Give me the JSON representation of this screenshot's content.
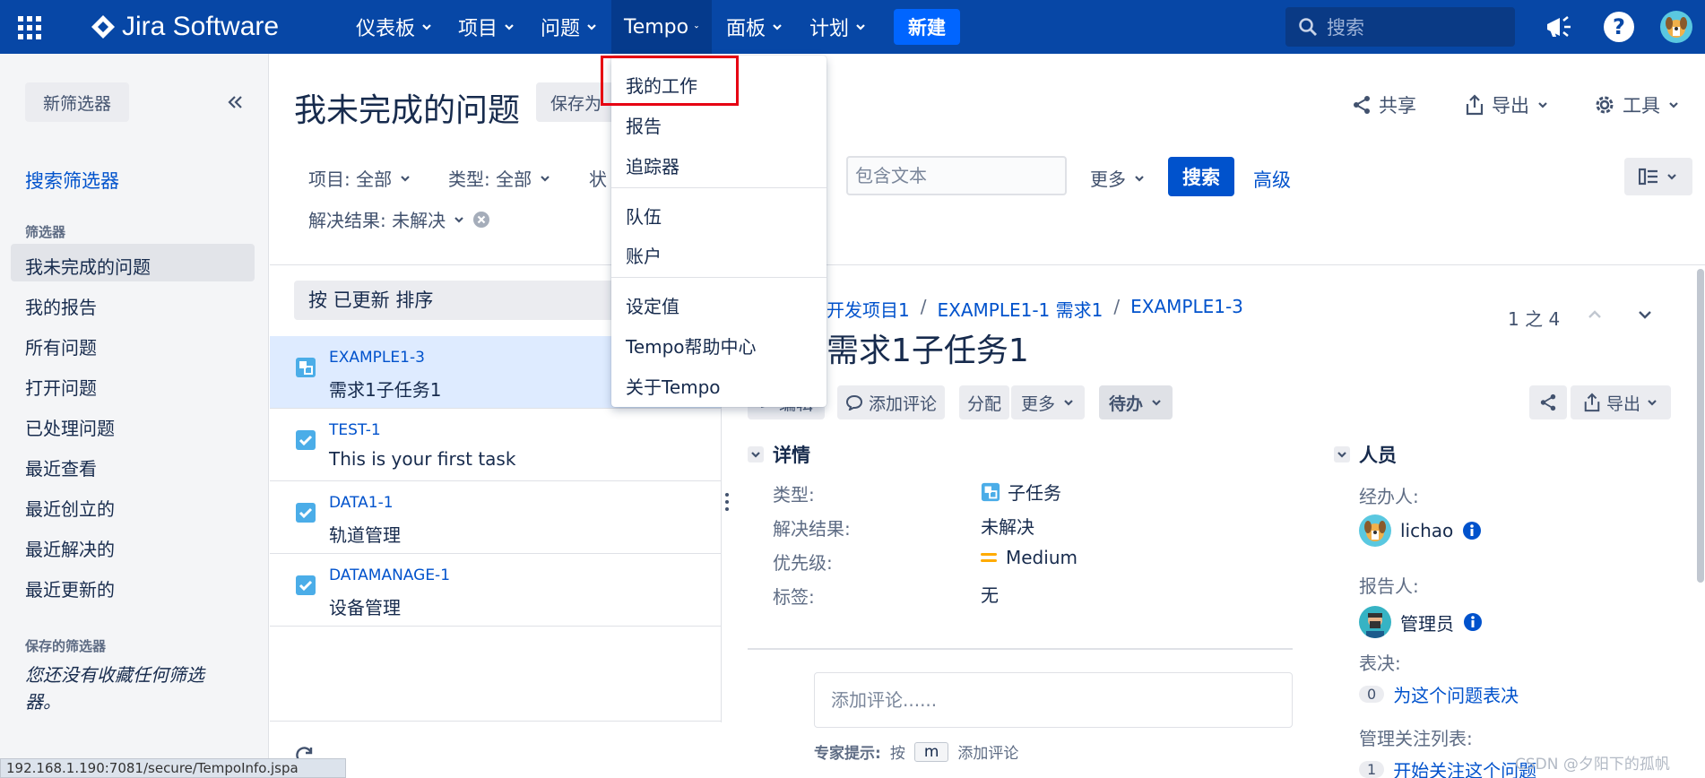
{
  "nav": {
    "logo": "Jira Software",
    "items": [
      "仪表板",
      "项目",
      "问题",
      "Tempo",
      "面板",
      "计划"
    ],
    "create": "新建",
    "search_placeholder": "搜索"
  },
  "sidebar": {
    "new_filter": "新筛选器",
    "search_filters": "搜索筛选器",
    "filters_heading": "筛选器",
    "filters": [
      "我未完成的问题",
      "我的报告",
      "所有问题",
      "打开问题",
      "已处理问题",
      "最近查看",
      "最近创立的",
      "最近解决的",
      "最近更新的"
    ],
    "saved_heading": "保存的筛选器",
    "saved_empty": "您还没有收藏任何筛选器。"
  },
  "header": {
    "title": "我未完成的问题",
    "save_as": "保存为",
    "share": "共享",
    "export": "导出",
    "tools": "工具"
  },
  "filters": {
    "project": "项目: 全部",
    "type": "类型: 全部",
    "status": "状",
    "resolution": "解决结果: 未解决",
    "text_placeholder": "包含文本",
    "more": "更多",
    "search": "搜索",
    "advanced": "高级"
  },
  "list": {
    "sort": "按 已更新 排序",
    "issues": [
      {
        "key": "EXAMPLE1-3",
        "summary": "需求1子任务1"
      },
      {
        "key": "TEST-1",
        "summary": "This is your first task"
      },
      {
        "key": "DATA1-1",
        "summary": "轨道管理"
      },
      {
        "key": "DATAMANAGE-1",
        "summary": "设备管理"
      }
    ]
  },
  "detail": {
    "breadcrumb": [
      "开发项目1",
      "EXAMPLE1-1 需求1",
      "EXAMPLE1-3"
    ],
    "pager": "1 之 4",
    "title": "需求1子任务1",
    "actions": {
      "edit": "编辑",
      "comment": "添加评论",
      "assign": "分配",
      "more": "更多",
      "status": "待办",
      "export": "导出"
    },
    "details_heading": "详情",
    "fields": {
      "type_label": "类型:",
      "type_value": "子任务",
      "resolution_label": "解决结果:",
      "resolution_value": "未解决",
      "priority_label": "优先级:",
      "priority_value": "Medium",
      "labels_label": "标签:",
      "labels_value": "无"
    },
    "comment_placeholder": "添加评论......",
    "tip_label": "专家提示:",
    "tip_press": "按",
    "tip_key": "m",
    "tip_action": "添加评论",
    "people_heading": "人员",
    "assignee_label": "经办人:",
    "assignee": "lichao",
    "reporter_label": "报告人:",
    "reporter": "管理员",
    "votes_label": "表决:",
    "votes_count": "0",
    "votes_link": "为这个问题表决",
    "watchers_label": "管理关注列表:",
    "watchers_count": "1",
    "watchers_link": "开始关注这个问题"
  },
  "tempo_menu": {
    "items_group1": [
      "我的工作",
      "报告",
      "追踪器"
    ],
    "items_group2": [
      "队伍",
      "账户"
    ],
    "items_group3": [
      "设定值",
      "Tempo帮助中心",
      "关于Tempo"
    ]
  },
  "status_url": "192.168.1.190:7081/secure/TempoInfo.jspa",
  "watermark": "CSDN @夕阳下的孤帆",
  "colors": {
    "nav": "#0747a6",
    "accent": "#0052cc",
    "highlight": "#e60012"
  }
}
